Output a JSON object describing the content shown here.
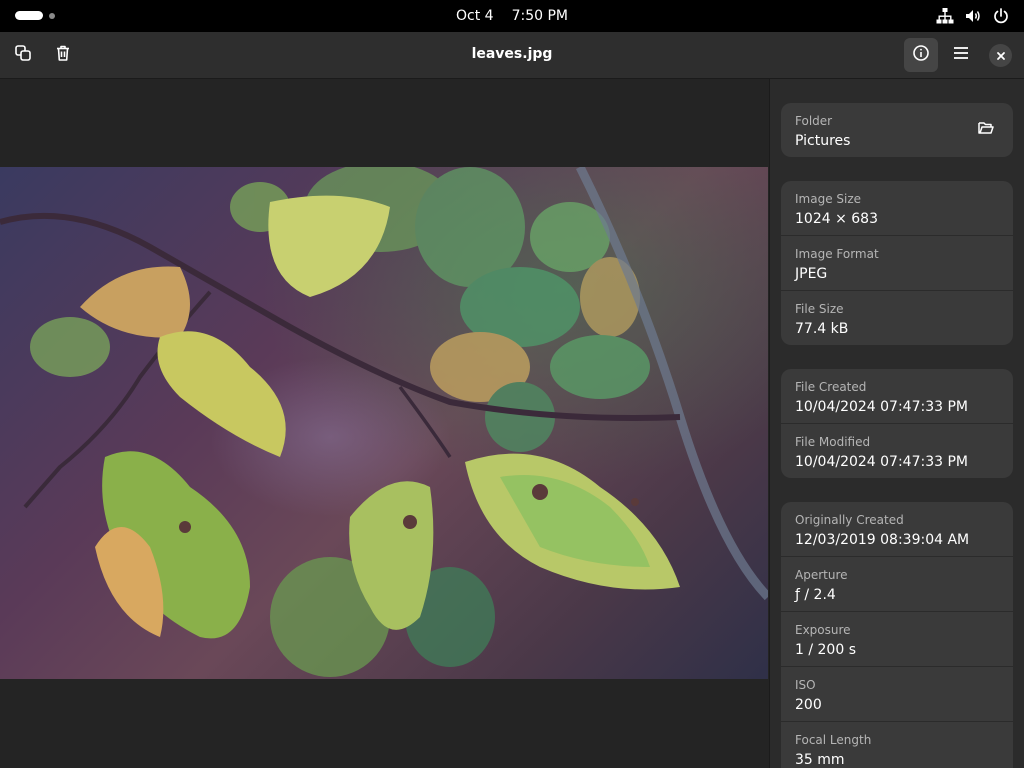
{
  "system": {
    "date": "Oct 4",
    "time": "7:50 PM"
  },
  "header": {
    "title": "leaves.jpg"
  },
  "icons": {
    "copy": "copy-icon",
    "delete": "trash-icon",
    "properties": "info-icon",
    "menu": "hamburger-menu-icon",
    "close": "close-icon",
    "open_folder": "folder-open-icon",
    "network": "network-icon",
    "volume": "volume-icon",
    "power": "power-icon"
  },
  "properties": {
    "folder": {
      "label": "Folder",
      "value": "Pictures"
    },
    "image_size": {
      "label": "Image Size",
      "value": "1024 × 683"
    },
    "image_format": {
      "label": "Image Format",
      "value": "JPEG"
    },
    "file_size": {
      "label": "File Size",
      "value": "77.4 kB"
    },
    "file_created": {
      "label": "File Created",
      "value": "10/04/2024 07:47:33 PM"
    },
    "file_modified": {
      "label": "File Modified",
      "value": "10/04/2024 07:47:33 PM"
    },
    "originally_created": {
      "label": "Originally Created",
      "value": "12/03/2019 08:39:04 AM"
    },
    "aperture": {
      "label": "Aperture",
      "value": "ƒ / 2.4"
    },
    "exposure": {
      "label": "Exposure",
      "value": "1 / 200 s"
    },
    "iso": {
      "label": "ISO",
      "value": "200"
    },
    "focal_length": {
      "label": "Focal Length",
      "value": "35 mm"
    }
  },
  "colors": {
    "accent_active": "#454545",
    "sidebar_card": "#3a3a3a",
    "background": "#242424"
  }
}
